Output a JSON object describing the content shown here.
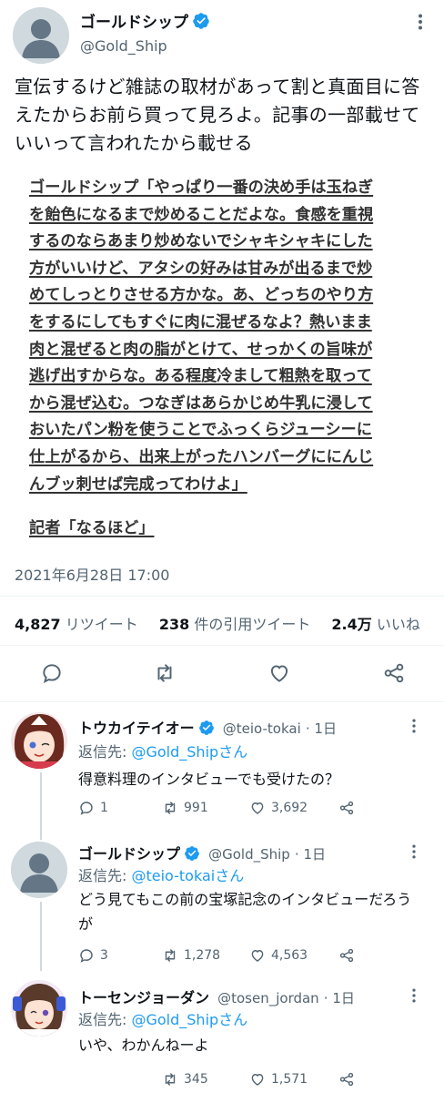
{
  "main_tweet": {
    "display_name": "ゴールドシップ",
    "handle": "@Gold_Ship",
    "text": "宣伝するけど雑誌の取材があって割と真面目に答えたからお前ら買って見ろよ。記事の一部載せていいって言われたから載せる",
    "quote_lines": [
      "ゴールドシップ「やっぱり一番の決め手は玉ねぎ",
      "を飴色になるまで炒めることだよな。食感を重視",
      "するのならあまり炒めないでシャキシャキにした",
      "方がいいけど、アタシの好みは甘みが出るまで炒",
      "めてしっとりさせる方かな。あ、どっちのやり方",
      "をするにしてもすぐに肉に混ぜるなよ？熱いまま",
      "肉と混ぜると肉の脂がとけて、せっかくの旨味が",
      "逃げ出すからな。ある程度冷まして粗熱を取って",
      "から混ぜ込む。つなぎはあらかじめ牛乳に浸して",
      "おいたパン粉を使うことでふっくらジューシーに",
      "仕上がるから、出来上がったハンバーグににんじ",
      "んブッ刺せば完成ってわけよ」"
    ],
    "reporter_line": "記者「なるほど」",
    "timestamp": "2021年6月28日 17:00",
    "stats": {
      "retweets": "4,827",
      "retweets_label": "リツイート",
      "quotes": "238",
      "quotes_label": "件の引用ツイート",
      "likes": "2.4万",
      "likes_label": "いいね"
    }
  },
  "replies": [
    {
      "display_name": "トウカイテイオー",
      "handle": "@teio-tokai",
      "time": "· 1日",
      "reply_label": "返信先: ",
      "reply_to": "@Gold_Shipさん",
      "text": "得意料理のインタビューでも受けたの？",
      "replies": "1",
      "retweets": "991",
      "likes": "3,692"
    },
    {
      "display_name": "ゴールドシップ",
      "handle": "@Gold_Ship",
      "time": "· 1日",
      "reply_label": "返信先: ",
      "reply_to": "@teio-tokaiさん",
      "text": "どう見てもこの前の宝塚記念のインタビューだろうが",
      "replies": "3",
      "retweets": "1,278",
      "likes": "4,563"
    },
    {
      "display_name": "トーセンジョーダン",
      "handle": "@tosen_jordan",
      "time": "· 1日",
      "reply_label": "返信先: ",
      "reply_to": "@Gold_Shipさん",
      "text": "いや、わかんねーよ",
      "replies": "",
      "retweets": "345",
      "likes": "1,571"
    }
  ],
  "colors": {
    "verified": "#1d9bf0",
    "link": "#1d9bf0",
    "muted": "#536471"
  }
}
